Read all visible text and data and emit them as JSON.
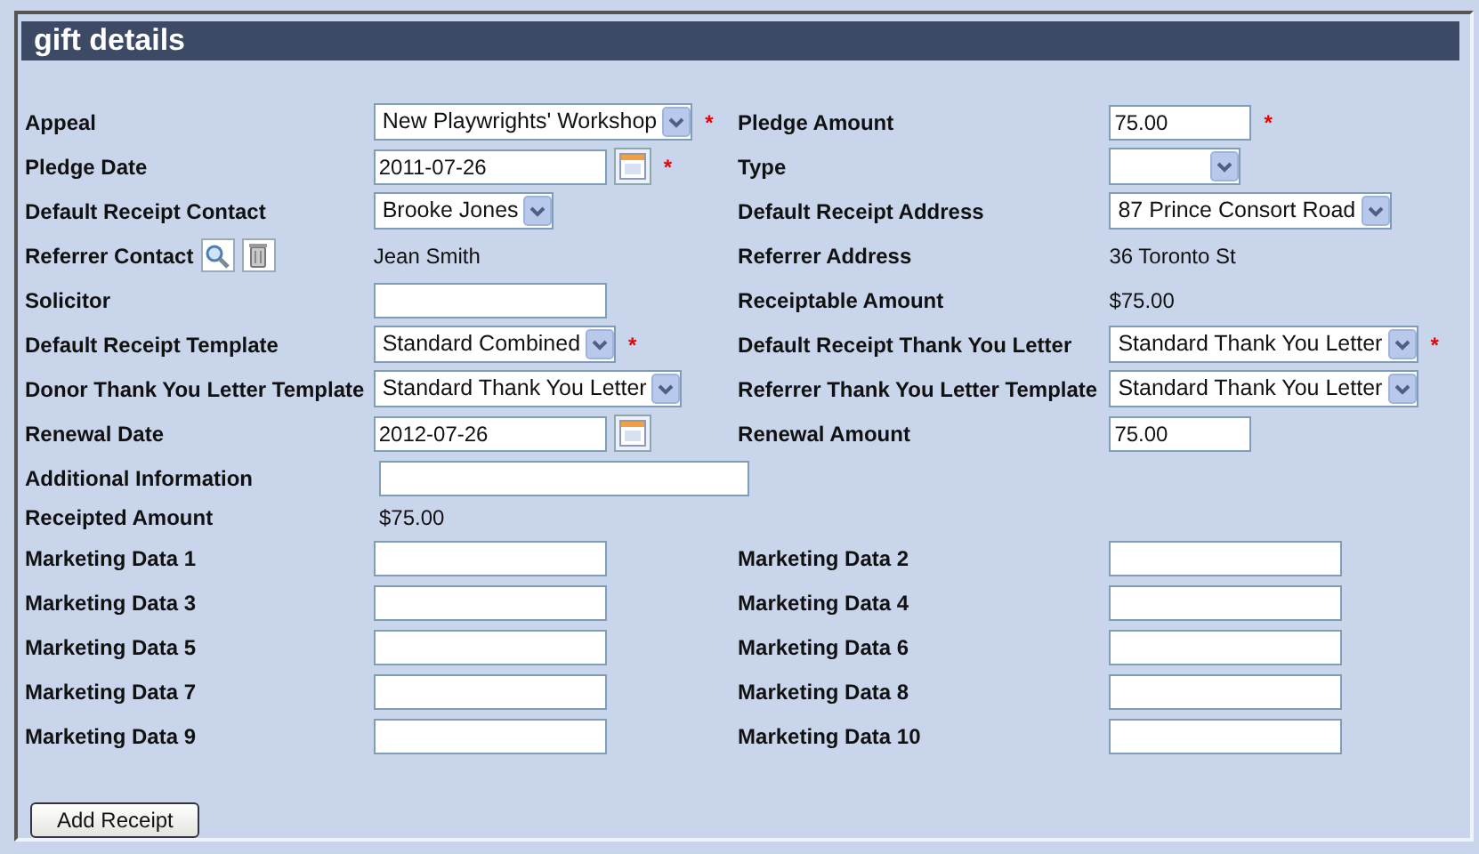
{
  "panel": {
    "title": "gift details"
  },
  "rows": [
    {
      "left": {
        "label": "Appeal",
        "kind": "select",
        "value": "New Playwrights' Workshop",
        "required_mark": "*"
      },
      "right": {
        "label": "Pledge Amount",
        "kind": "amount",
        "value": "75.00",
        "required_mark": "*"
      }
    },
    {
      "left": {
        "label": "Pledge Date",
        "kind": "date",
        "value": "2011-07-26",
        "required_mark": "*"
      },
      "right": {
        "label": "Type",
        "kind": "select"
      }
    },
    {
      "left": {
        "label": "Default Receipt Contact",
        "kind": "select",
        "value": "Brooke Jones"
      },
      "right": {
        "label": "Default Receipt Address",
        "kind": "select",
        "value": "87 Prince Consort Road"
      }
    },
    {
      "left": {
        "label": "Referrer Contact",
        "kind": "lookup",
        "value": "Jean Smith"
      },
      "right": {
        "label": "Referrer Address",
        "kind": "static",
        "value": "36 Toronto St"
      }
    },
    {
      "left": {
        "label": "Solicitor",
        "kind": "text"
      },
      "right": {
        "label": "Receiptable Amount",
        "kind": "static",
        "value": "$75.00"
      }
    },
    {
      "left": {
        "label": "Default Receipt Template",
        "kind": "select",
        "value": "Standard Combined",
        "required_mark": "*"
      },
      "right": {
        "label": "Default Receipt Thank You Letter",
        "kind": "select",
        "value": "Standard Thank You Letter",
        "required_mark": "*"
      }
    },
    {
      "left": {
        "label": "Donor Thank You Letter Template",
        "kind": "select",
        "value": "Standard Thank You Letter"
      },
      "right": {
        "label": "Referrer Thank You Letter Template",
        "kind": "select",
        "value": "Standard Thank You Letter"
      }
    },
    {
      "left": {
        "label": "Renewal Date",
        "kind": "date",
        "value": "2012-07-26"
      },
      "right": {
        "label": "Renewal Amount",
        "kind": "amount",
        "value": "75.00"
      }
    },
    {
      "left": {
        "label": "Additional Information",
        "kind": "wide"
      }
    },
    {
      "left": {
        "label": "Receipted Amount",
        "kind": "static",
        "value": "$75.00"
      }
    },
    {
      "left": {
        "label": "Marketing Data 1",
        "kind": "text"
      },
      "right": {
        "label": "Marketing Data 2",
        "kind": "text"
      }
    },
    {
      "left": {
        "label": "Marketing Data 3",
        "kind": "text"
      },
      "right": {
        "label": "Marketing Data 4",
        "kind": "text"
      }
    },
    {
      "left": {
        "label": "Marketing Data 5",
        "kind": "text"
      },
      "right": {
        "label": "Marketing Data 6",
        "kind": "text"
      }
    },
    {
      "left": {
        "label": "Marketing Data 7",
        "kind": "text"
      },
      "right": {
        "label": "Marketing Data 8",
        "kind": "text"
      }
    },
    {
      "left": {
        "label": "Marketing Data 9",
        "kind": "text"
      },
      "right": {
        "label": "Marketing Data 10",
        "kind": "text"
      }
    }
  ],
  "buttons": [
    "Add Receipt"
  ]
}
